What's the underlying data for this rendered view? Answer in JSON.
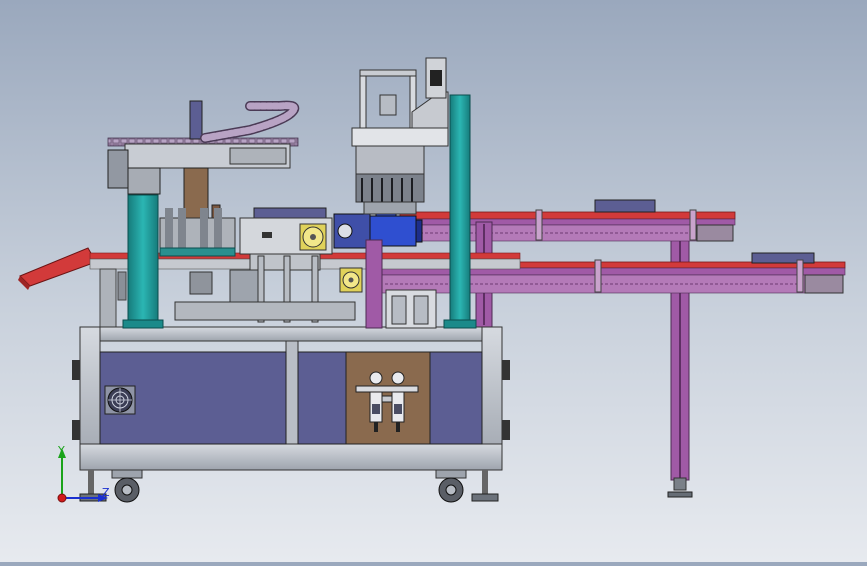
{
  "view": {
    "background_top": "#9aa8bd",
    "background_bottom": "#e7eaef"
  },
  "colors": {
    "frame_gray": "#b9bec6",
    "panel_purple": "#5c5e93",
    "cabinet_brown": "#8a6a4e",
    "column_teal": "#1f9a9a",
    "conveyor_red": "#d23a3a",
    "conveyor_purple": "#a05aa6",
    "motor_blue": "#2f4fd0",
    "axis_y": "#1aa31a",
    "axis_z": "#1a2fd0",
    "axis_x": "#d21a1a"
  },
  "triad": {
    "y_label": "Y",
    "z_label": "Z"
  },
  "icons": [
    "fan-grill-icon",
    "fan-icon",
    "air-filter-regulator-icon",
    "caster-wheel-icon",
    "leveling-foot-icon",
    "cable-chain-icon"
  ]
}
